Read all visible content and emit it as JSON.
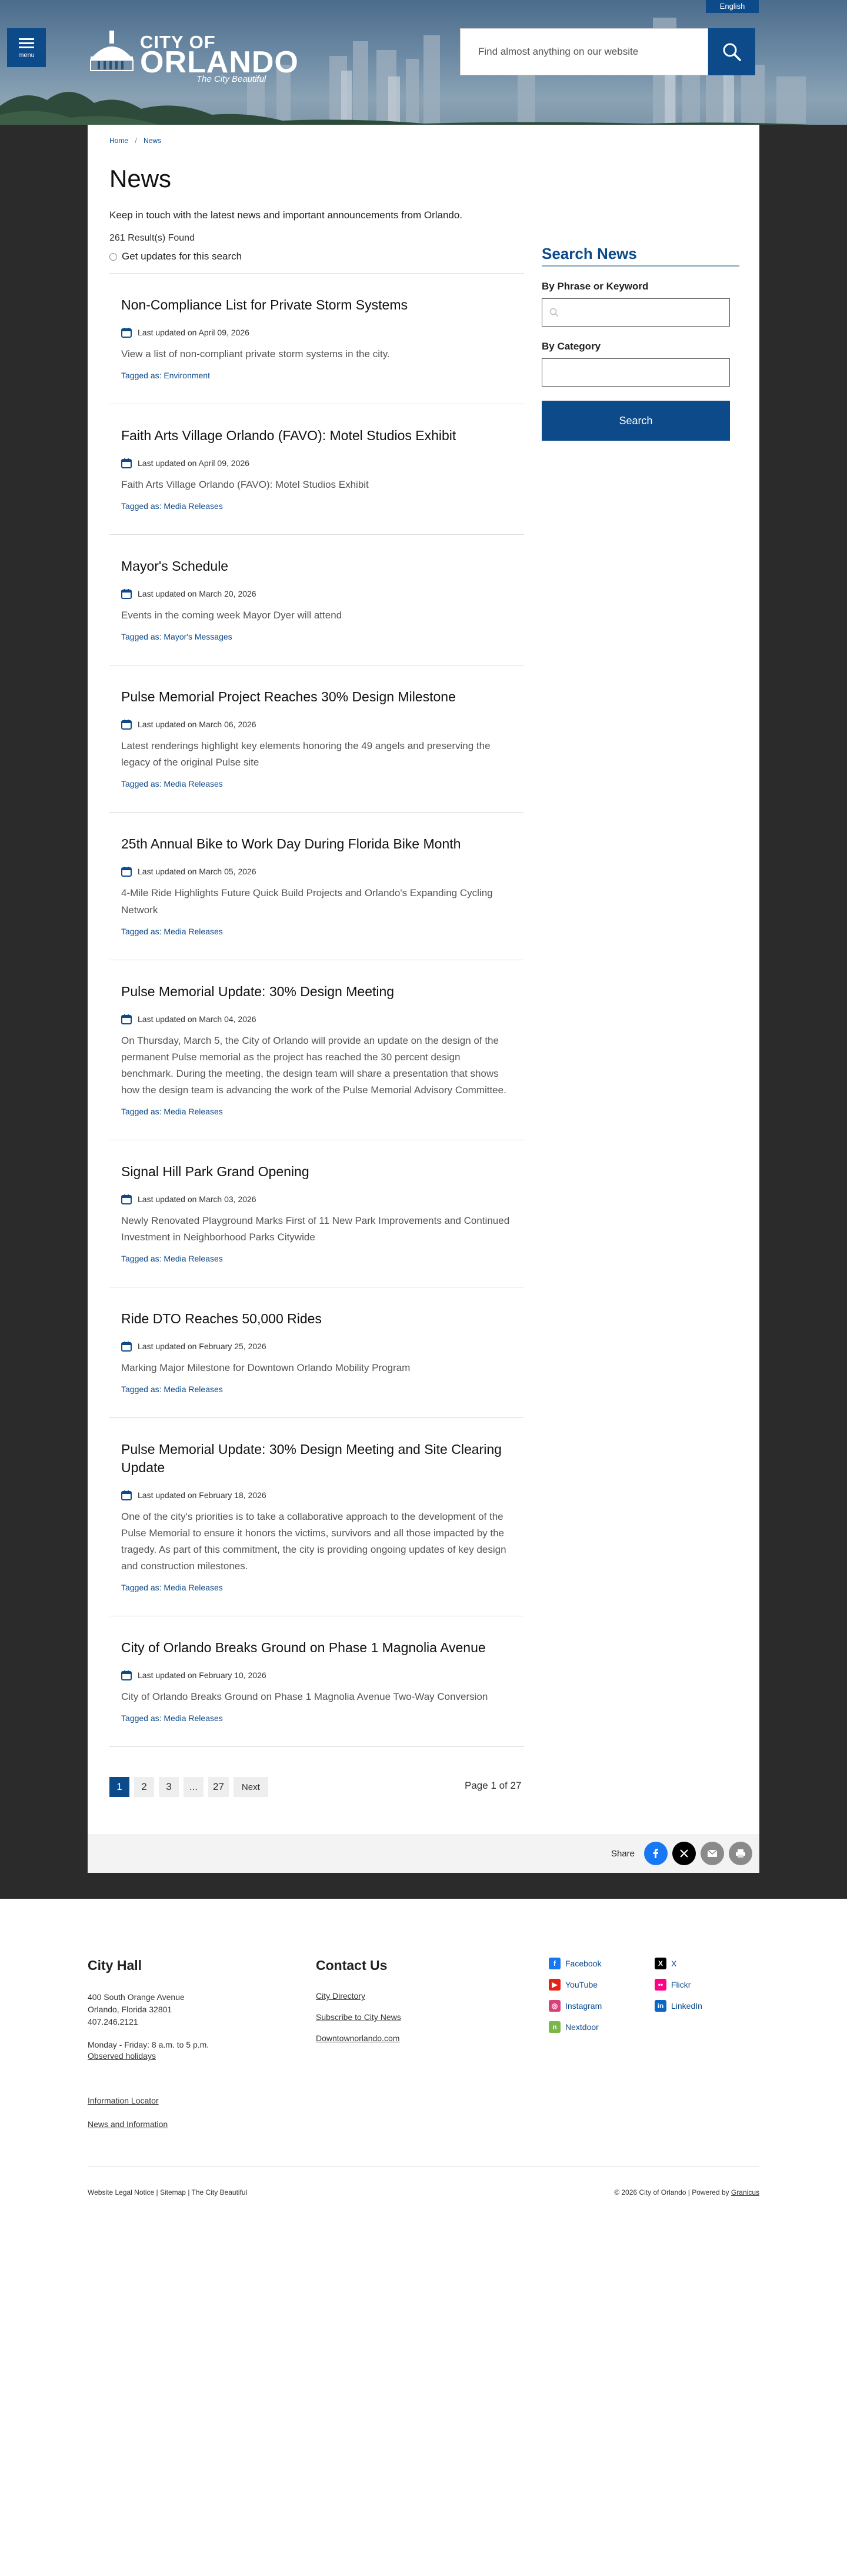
{
  "header": {
    "language": "English",
    "menu_label": "menu",
    "logo_city_of": "CITY OF",
    "logo_orlando": "ORLANDO",
    "logo_tagline": "The City Beautiful",
    "search_placeholder": "Find almost anything on our website"
  },
  "breadcrumb": {
    "home": "Home",
    "separator": "/",
    "current": "News"
  },
  "page": {
    "title": "News",
    "intro": "Keep in touch with the latest news and important announcements from Orlando.",
    "results": "261 Result(s) Found",
    "updates_label": "Get updates for this search"
  },
  "news": [
    {
      "title": "Non-Compliance List for Private Storm Systems",
      "date": "Last updated on April 09, 2026",
      "desc": "View a list of non-compliant private storm systems in the city.",
      "tag_prefix": "Tagged as:",
      "tag": "Environment"
    },
    {
      "title": "Faith Arts Village Orlando (FAVO): Motel Studios Exhibit",
      "date": "Last updated on April 09, 2026",
      "desc": "Faith Arts Village Orlando (FAVO): Motel Studios Exhibit",
      "tag_prefix": "Tagged as:",
      "tag": "Media Releases"
    },
    {
      "title": "Mayor's Schedule",
      "date": "Last updated on March 20, 2026",
      "desc": "Events in the coming week Mayor Dyer will attend",
      "tag_prefix": "Tagged as:",
      "tag": "Mayor's Messages"
    },
    {
      "title": "Pulse Memorial Project Reaches 30% Design Milestone",
      "date": "Last updated on March 06, 2026",
      "desc": "Latest renderings highlight key elements honoring the 49 angels and preserving the legacy of the original Pulse site",
      "tag_prefix": "Tagged as:",
      "tag": "Media Releases"
    },
    {
      "title": "25th Annual Bike to Work Day During Florida Bike Month",
      "date": "Last updated on March 05, 2026",
      "desc": "4-Mile Ride Highlights Future Quick Build Projects and Orlando's Expanding Cycling Network",
      "tag_prefix": "Tagged as:",
      "tag": "Media Releases"
    },
    {
      "title": "Pulse Memorial Update: 30% Design Meeting",
      "date": "Last updated on March 04, 2026",
      "desc": "On Thursday, March 5, the City of Orlando will provide an update on the design of the permanent Pulse memorial as the project has reached the 30 percent design benchmark. During the meeting, the design team will share a presentation that shows how the design team is advancing the work of the Pulse Memorial Advisory Committee.",
      "tag_prefix": "Tagged as:",
      "tag": "Media Releases"
    },
    {
      "title": "Signal Hill Park Grand Opening",
      "date": "Last updated on March 03, 2026",
      "desc": "Newly Renovated Playground Marks First of 11 New Park Improvements and Continued Investment in Neighborhood Parks Citywide",
      "tag_prefix": "Tagged as:",
      "tag": "Media Releases"
    },
    {
      "title": "Ride DTO Reaches 50,000 Rides",
      "date": "Last updated on February 25, 2026",
      "desc": "Marking Major Milestone for Downtown Orlando Mobility Program",
      "tag_prefix": "Tagged as:",
      "tag": "Media Releases"
    },
    {
      "title": "Pulse Memorial Update: 30% Design Meeting and Site Clearing Update",
      "date": "Last updated on February 18, 2026",
      "desc": "One of the city's priorities is to take a collaborative approach to the development of the Pulse Memorial to ensure it honors the victims, survivors and all those impacted by the tragedy. As part of this commitment, the city is providing ongoing updates of key design and construction milestones.",
      "tag_prefix": "Tagged as:",
      "tag": "Media Releases"
    },
    {
      "title": "City of Orlando Breaks Ground on Phase 1 Magnolia Avenue",
      "date": "Last updated on February 10, 2026",
      "desc": "City of Orlando Breaks Ground on Phase 1 Magnolia Avenue Two-Way Conversion",
      "tag_prefix": "Tagged as:",
      "tag": "Media Releases"
    }
  ],
  "sidebar": {
    "title": "Search News",
    "phrase_label": "By Phrase or Keyword",
    "category_label": "By Category",
    "search_button": "Search"
  },
  "pagination": {
    "pages": [
      "1",
      "2",
      "3",
      "...",
      "27"
    ],
    "next": "Next",
    "page_of": "Page 1 of 27"
  },
  "share": {
    "label": "Share",
    "icons": [
      "facebook-icon",
      "x-icon",
      "email-icon",
      "print-icon"
    ],
    "colors": {
      "facebook": "#1877f2",
      "x": "#000000",
      "email": "#8a8a8a",
      "print": "#8a8a8a"
    }
  },
  "footer": {
    "city_hall": {
      "heading": "City Hall",
      "address1": "400 South Orange Avenue",
      "address2": "Orlando, Florida 32801",
      "phone": "407.246.2121",
      "hours": "Monday - Friday: 8 a.m. to 5 p.m.",
      "holidays": "Observed holidays",
      "locator": "Information Locator",
      "news": "News and Information"
    },
    "contact": {
      "heading": "Contact Us",
      "links": [
        "City Directory",
        "Subscribe to City News",
        "Downtownorlando.com"
      ]
    },
    "social_left": [
      "Facebook",
      "YouTube",
      "Instagram",
      "Nextdoor"
    ],
    "social_right": [
      "X",
      "Flickr",
      "LinkedIn"
    ],
    "bottom_left": "Website Legal Notice | Sitemap | The City Beautiful",
    "bottom_right_prefix": "© 2026 City of Orlando | Powered by ",
    "bottom_right_link": "Granicus"
  },
  "colors": {
    "brand_blue": "#0c4a8a",
    "dark_bg": "#2b2b2b"
  }
}
